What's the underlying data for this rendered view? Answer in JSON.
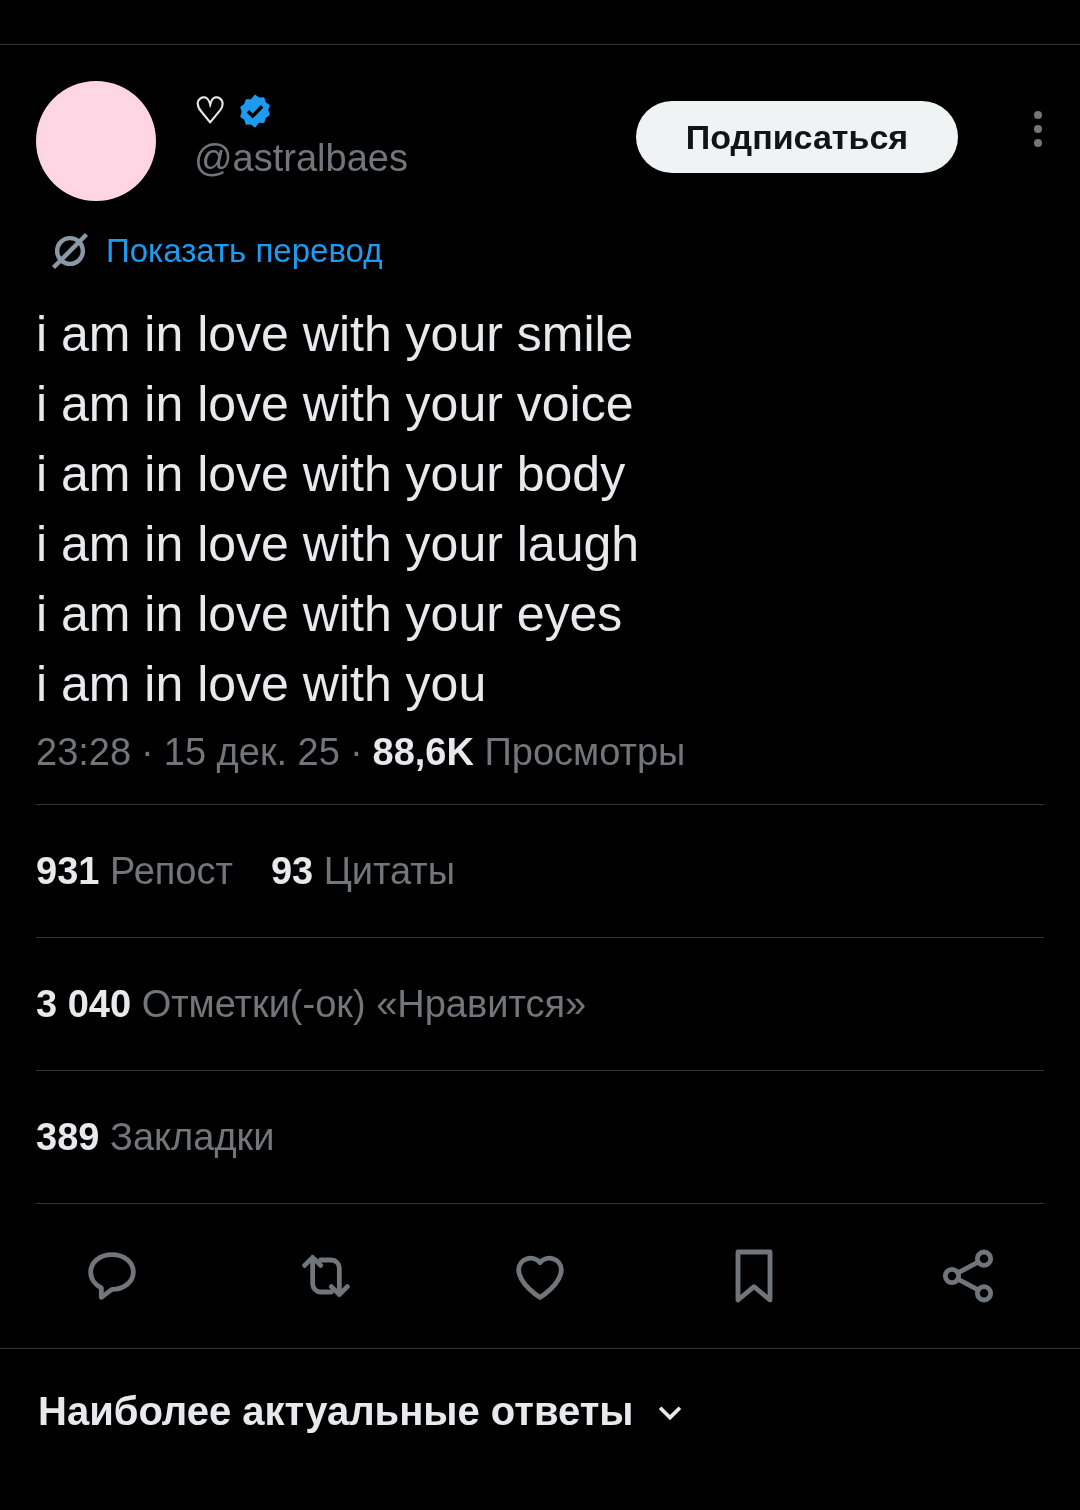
{
  "author": {
    "display_name": "♡",
    "verified": true,
    "handle": "@astralbaes"
  },
  "follow_button": "Подписаться",
  "translate_link": "Показать перевод",
  "body_lines": [
    "i am in love with your smile",
    "i am in love with your voice",
    "i am in love with your body",
    "i am in love with your laugh",
    "i am in love with your eyes",
    "i am in love with you"
  ],
  "meta": {
    "separator": "·",
    "time": "23:28",
    "date": "15 дек. 25",
    "views_count": "88,6K",
    "views_label": "Просмотры"
  },
  "stat_rows": [
    [
      {
        "count": "931",
        "label": "Репост"
      },
      {
        "count": "93",
        "label": "Цитаты"
      }
    ],
    [
      {
        "count": "3 040",
        "label": "Отметки(-ок) «Нравится»"
      }
    ],
    [
      {
        "count": "389",
        "label": "Закладки"
      }
    ]
  ],
  "actions": [
    {
      "kind": "reply"
    },
    {
      "kind": "repost"
    },
    {
      "kind": "like"
    },
    {
      "kind": "bookmark"
    },
    {
      "kind": "share"
    }
  ],
  "replies_sort": "Наиболее актуальные ответы"
}
